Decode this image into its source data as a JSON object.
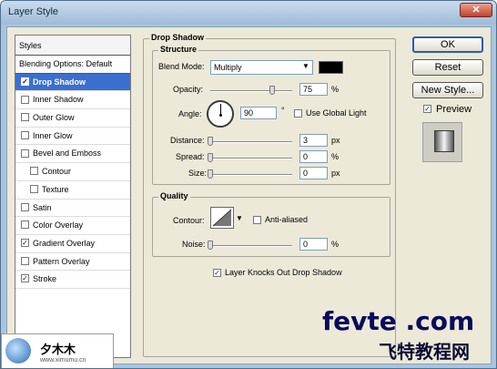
{
  "window": {
    "title": "Layer Style",
    "close_label": "✕"
  },
  "styles": {
    "header": "Styles",
    "blending_options": "Blending Options: Default",
    "items": [
      {
        "label": "Drop Shadow",
        "checked": true,
        "selected": true,
        "indent": false
      },
      {
        "label": "Inner Shadow",
        "checked": false,
        "selected": false,
        "indent": false
      },
      {
        "label": "Outer Glow",
        "checked": false,
        "selected": false,
        "indent": false
      },
      {
        "label": "Inner Glow",
        "checked": false,
        "selected": false,
        "indent": false
      },
      {
        "label": "Bevel and Emboss",
        "checked": false,
        "selected": false,
        "indent": false
      },
      {
        "label": "Contour",
        "checked": false,
        "selected": false,
        "indent": true
      },
      {
        "label": "Texture",
        "checked": false,
        "selected": false,
        "indent": true
      },
      {
        "label": "Satin",
        "checked": false,
        "selected": false,
        "indent": false
      },
      {
        "label": "Color Overlay",
        "checked": false,
        "selected": false,
        "indent": false
      },
      {
        "label": "Gradient Overlay",
        "checked": true,
        "selected": false,
        "indent": false
      },
      {
        "label": "Pattern Overlay",
        "checked": false,
        "selected": false,
        "indent": false
      },
      {
        "label": "Stroke",
        "checked": true,
        "selected": false,
        "indent": false
      }
    ]
  },
  "drop_shadow": {
    "title": "Drop Shadow",
    "structure": {
      "title": "Structure",
      "blend_mode_label": "Blend Mode:",
      "blend_mode_value": "Multiply",
      "blend_color": "#000000",
      "opacity_label": "Opacity:",
      "opacity_value": "75",
      "opacity_unit": "%",
      "opacity_level": 0.75,
      "angle_label": "Angle:",
      "angle_value": "90",
      "angle_unit": "°",
      "use_global_light_label": "Use Global Light",
      "use_global_light_checked": false,
      "distance_label": "Distance:",
      "distance_value": "3",
      "distance_unit": "px",
      "distance_level": 0.0,
      "spread_label": "Spread:",
      "spread_value": "0",
      "spread_unit": "%",
      "spread_level": 0.0,
      "size_label": "Size:",
      "size_value": "0",
      "size_unit": "px",
      "size_level": 0.0
    },
    "quality": {
      "title": "Quality",
      "contour_label": "Contour:",
      "anti_aliased_label": "Anti-aliased",
      "anti_aliased_checked": false,
      "noise_label": "Noise:",
      "noise_value": "0",
      "noise_unit": "%",
      "noise_level": 0.0
    },
    "knockout_label": "Layer Knocks Out Drop Shadow",
    "knockout_checked": true
  },
  "buttons": {
    "ok": "OK",
    "reset": "Reset",
    "new_style": "New Style...",
    "preview_label": "Preview",
    "preview_checked": true
  },
  "watermarks": {
    "fevte": "fevte .com",
    "fevte_cn": "飞特教程网",
    "logo_text": "夕木木",
    "logo_url": "www.ximumu.cn"
  }
}
